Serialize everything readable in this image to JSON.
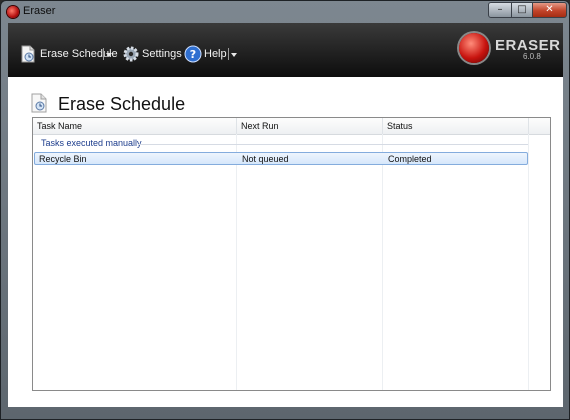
{
  "window": {
    "title": "Eraser",
    "controls": {
      "minimize": "–",
      "maximize": "□",
      "close": "✕"
    }
  },
  "toolbar": {
    "items": [
      {
        "label": "Erase Schedule",
        "icon": "erase-schedule-icon"
      },
      {
        "label": "Settings",
        "icon": "settings-gear-icon"
      },
      {
        "label": "Help",
        "icon": "help-icon"
      }
    ]
  },
  "brand": {
    "name": "ERASER",
    "version": "6.0.8"
  },
  "page": {
    "title": "Erase Schedule"
  },
  "table": {
    "columns": [
      "Task Name",
      "Next Run",
      "Status"
    ],
    "group": "Tasks executed manually",
    "rows": [
      {
        "task": "Recycle Bin",
        "next_run": "Not queued",
        "status": "Completed"
      }
    ]
  },
  "colors": {
    "accent": "#c8140f",
    "selection": "#d6e7fb",
    "group_text": "#1c3c8c"
  }
}
